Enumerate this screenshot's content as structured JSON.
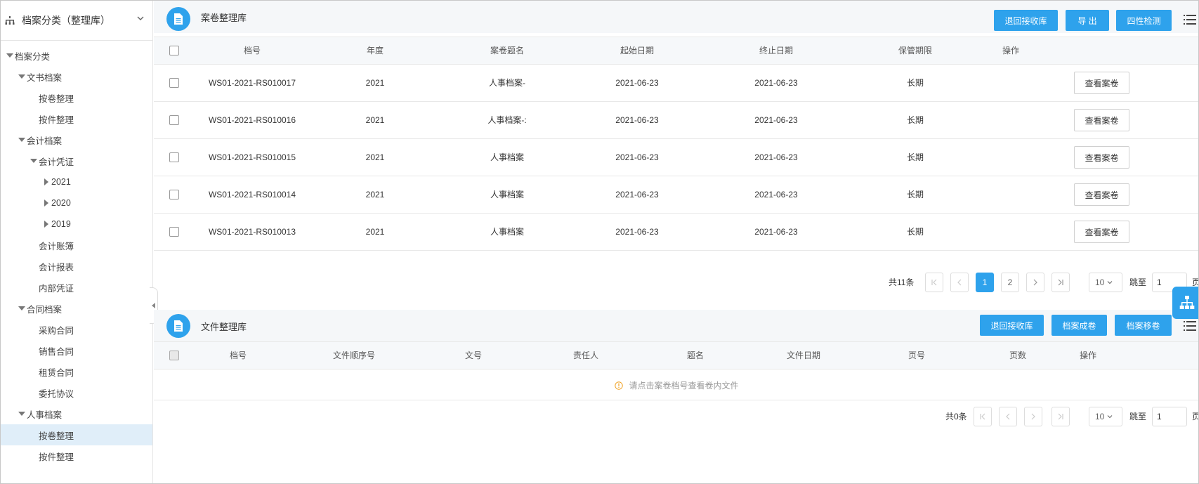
{
  "sidebar": {
    "title": "档案分类（整理库）",
    "tree": [
      {
        "label": "档案分类",
        "caret": "down",
        "depth": 0
      },
      {
        "label": "文书档案",
        "caret": "down",
        "depth": 1
      },
      {
        "label": "按卷整理",
        "caret": "none",
        "depth": 2
      },
      {
        "label": "按件整理",
        "caret": "none",
        "depth": 2
      },
      {
        "label": "会计档案",
        "caret": "down",
        "depth": 1
      },
      {
        "label": "会计凭证",
        "caret": "down",
        "depth": 2
      },
      {
        "label": "2021",
        "caret": "right",
        "depth": 3
      },
      {
        "label": "2020",
        "caret": "right",
        "depth": 3
      },
      {
        "label": "2019",
        "caret": "right",
        "depth": 3
      },
      {
        "label": "会计账簿",
        "caret": "none",
        "depth": 2
      },
      {
        "label": "会计报表",
        "caret": "none",
        "depth": 2
      },
      {
        "label": "内部凭证",
        "caret": "none",
        "depth": 2
      },
      {
        "label": "合同档案",
        "caret": "down",
        "depth": 1
      },
      {
        "label": "采购合同",
        "caret": "none",
        "depth": 2
      },
      {
        "label": "销售合同",
        "caret": "none",
        "depth": 2
      },
      {
        "label": "租赁合同",
        "caret": "none",
        "depth": 2
      },
      {
        "label": "委托协议",
        "caret": "none",
        "depth": 2
      },
      {
        "label": "人事档案",
        "caret": "down",
        "depth": 1
      },
      {
        "label": "按卷整理",
        "caret": "none",
        "depth": 2,
        "selected": true
      },
      {
        "label": "按件整理",
        "caret": "none",
        "depth": 2
      }
    ]
  },
  "volume_panel": {
    "title": "案卷整理库",
    "buttons": [
      "退回接收库",
      "导 出",
      "四性检测"
    ],
    "columns": [
      "档号",
      "年度",
      "案卷题名",
      "起始日期",
      "终止日期",
      "保管期限",
      "操作"
    ],
    "rows": [
      {
        "code": "WS01-2021-RS010017",
        "year": "2021",
        "title": "人事档案-",
        "start": "2021-06-23",
        "end": "2021-06-23",
        "period": "长期",
        "action": "查看案卷"
      },
      {
        "code": "WS01-2021-RS010016",
        "year": "2021",
        "title": "人事档案-:",
        "start": "2021-06-23",
        "end": "2021-06-23",
        "period": "长期",
        "action": "查看案卷"
      },
      {
        "code": "WS01-2021-RS010015",
        "year": "2021",
        "title": "人事档案",
        "start": "2021-06-23",
        "end": "2021-06-23",
        "period": "长期",
        "action": "查看案卷"
      },
      {
        "code": "WS01-2021-RS010014",
        "year": "2021",
        "title": "人事档案",
        "start": "2021-06-23",
        "end": "2021-06-23",
        "period": "长期",
        "action": "查看案卷"
      },
      {
        "code": "WS01-2021-RS010013",
        "year": "2021",
        "title": "人事档案",
        "start": "2021-06-23",
        "end": "2021-06-23",
        "period": "长期",
        "action": "查看案卷"
      }
    ],
    "pager": {
      "total": "共11条",
      "pages": [
        "1",
        "2"
      ],
      "active_page": "1",
      "page_size": "10",
      "jump_label": "跳至",
      "jump_value": "1",
      "suffix": "页"
    }
  },
  "file_panel": {
    "title": "文件整理库",
    "buttons": [
      "退回接收库",
      "档案成卷",
      "档案移卷"
    ],
    "columns": [
      "档号",
      "文件顺序号",
      "文号",
      "责任人",
      "题名",
      "文件日期",
      "页号",
      "页数",
      "操作"
    ],
    "empty_text": "请点击案卷档号查看卷内文件",
    "pager": {
      "total": "共0条",
      "page_size": "10",
      "jump_label": "跳至",
      "jump_value": "1",
      "suffix": "页"
    }
  },
  "colors": {
    "accent": "#2ea2ec",
    "selected_bg": "#e0eef9",
    "header_bg": "#f5f7f9"
  }
}
